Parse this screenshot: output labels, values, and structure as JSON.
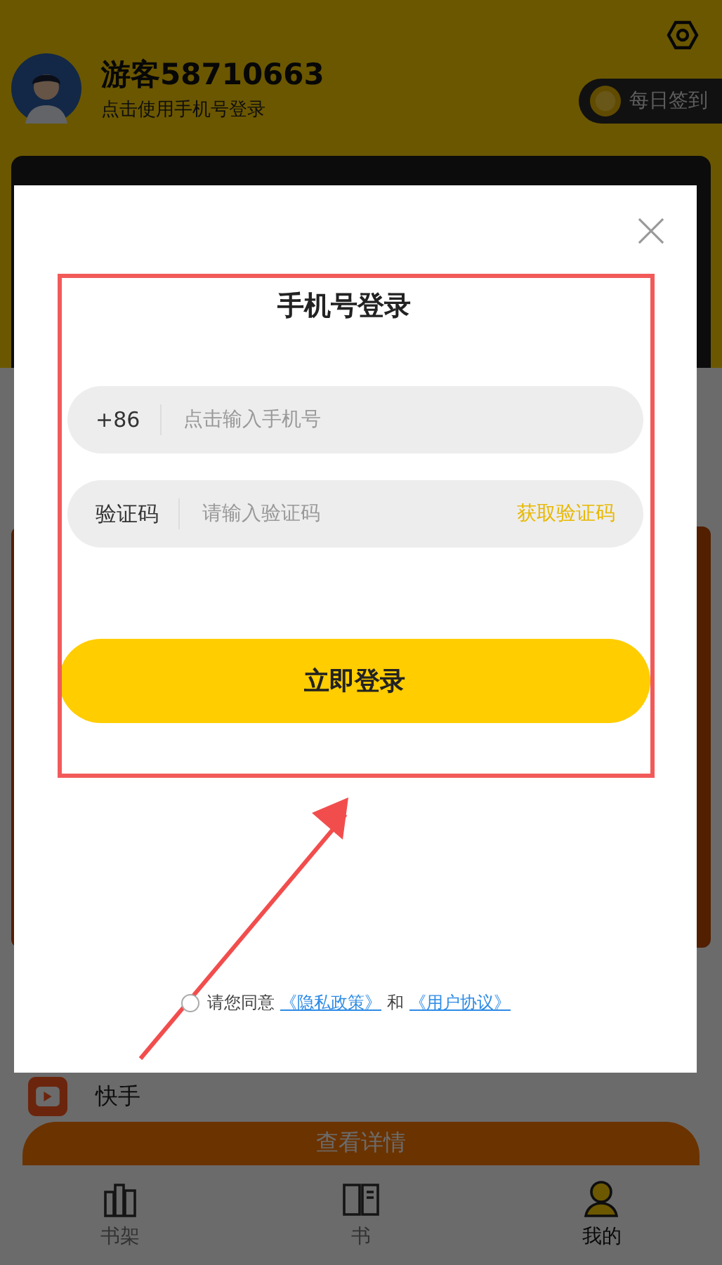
{
  "header": {
    "username": "游客58710663",
    "subtitle": "点击使用手机号登录",
    "checkin": "每日签到"
  },
  "behind": {
    "app_name": "快手",
    "details_button": "查看详情"
  },
  "tabs": [
    {
      "label": "书架",
      "kind": "shelf",
      "selected": false
    },
    {
      "label": "书",
      "kind": "book",
      "selected": false
    },
    {
      "label": "我的",
      "kind": "user",
      "selected": true
    }
  ],
  "login": {
    "title": "手机号登录",
    "country_code": "+86",
    "phone_placeholder": "点击输入手机号",
    "code_label": "验证码",
    "code_placeholder": "请输入验证码",
    "get_code": "获取验证码",
    "submit": "立即登录",
    "agreement": {
      "checked": false,
      "prefix": "请您同意",
      "privacy": "《隐私政策》",
      "and": "和",
      "terms": "《用户协议》"
    }
  }
}
